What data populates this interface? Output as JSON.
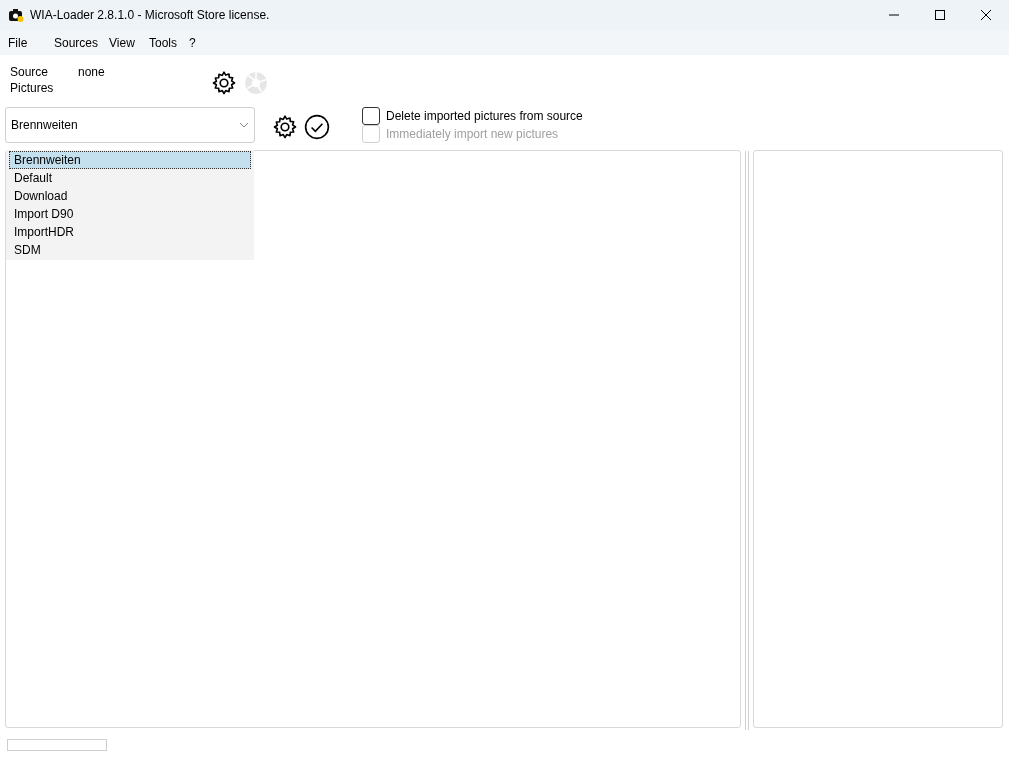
{
  "window": {
    "title": "WIA-Loader 2.8.1.0 - Microsoft Store license."
  },
  "menu": [
    "File",
    "Sources",
    "View",
    "Tools",
    "?"
  ],
  "source": {
    "label": "Source",
    "value": "none"
  },
  "pictures_label": "Pictures",
  "profile": {
    "value": "Brennweiten",
    "options": [
      {
        "label": "Brennweiten",
        "selected": true
      },
      {
        "label": "Default",
        "selected": false
      },
      {
        "label": "Download",
        "selected": false
      },
      {
        "label": "Import D90",
        "selected": false
      },
      {
        "label": "ImportHDR",
        "selected": false
      },
      {
        "label": "SDM",
        "selected": false
      }
    ]
  },
  "options": [
    {
      "label": "Delete imported pictures from source",
      "checked": false,
      "disabled": false
    },
    {
      "label": "Immediately import new pictures",
      "checked": false,
      "disabled": true
    }
  ],
  "progress": {
    "level": 0
  }
}
